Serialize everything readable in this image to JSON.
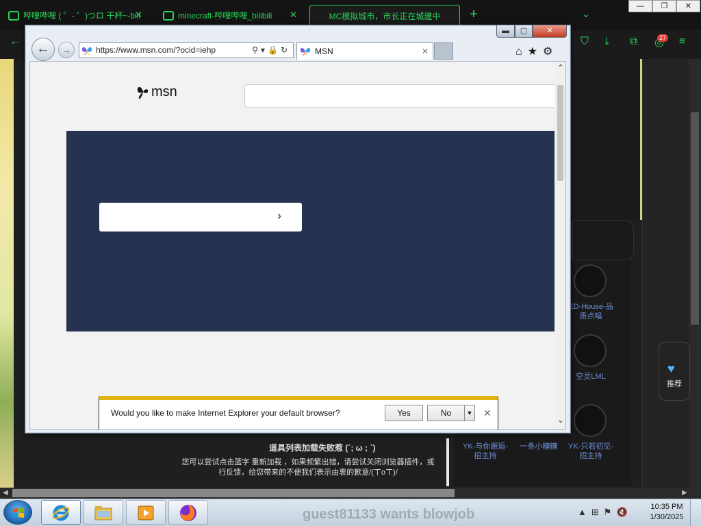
{
  "background_browser": {
    "tabs": [
      {
        "title": "哔哩哔哩 ( ゜- ゜)つロ 干杯~-bili"
      },
      {
        "title": "minecraft-哔哩哔哩_bilibili"
      },
      {
        "title": "MC模拟城市，市长正在城建中"
      }
    ],
    "badge_count": "27",
    "sidebar": {
      "recommend_label": "推荐"
    },
    "up_labels": [
      "ED-House-品质点唱",
      "空灵LML",
      "YK-与你邂逅-招主持",
      "一条小糖糖",
      "YK-只若初见-招主持"
    ],
    "error": {
      "title": "道具列表加载失败惹 (´; ω ; `)",
      "message": "您可以尝试点击蓝字 重新加载 ，如果频繁出错，请尝试关闭浏览器插件，或",
      "message2": "行反馈，给您带来的不便我们表示由衷的歉意/(ㄒoㄒ)/"
    },
    "accent_color": "#29d55a"
  },
  "ie": {
    "address": "https://www.msn.com/?ocid=iehp",
    "tab_title": "MSN",
    "msn_logo": "msn",
    "notification": {
      "text": "Would you like to make Internet Explorer your default browser?",
      "yes": "Yes",
      "no": "No"
    }
  },
  "taskbar": {
    "ghost_text": "guest81133 wants blowjob",
    "clock_time": "10:35 PM",
    "clock_date": "1/30/2025",
    "pinned": [
      "internet-explorer-icon",
      "windows-explorer-icon",
      "media-player-icon",
      "firefox-icon"
    ]
  }
}
